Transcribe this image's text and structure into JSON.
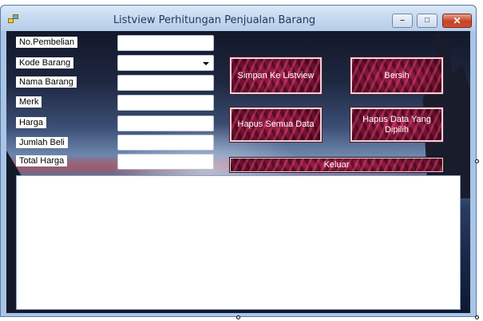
{
  "window": {
    "title": "Listview Perhitungan Penjualan Barang",
    "buttons": {
      "minimize_icon": "minimize-icon",
      "maximize_icon": "maximize-icon",
      "close_icon": "close-icon"
    }
  },
  "form": {
    "labels": {
      "no_pembelian": "No.Pembelian",
      "kode_barang": "Kode Barang",
      "nama_barang": "Nama Barang",
      "merk": "Merk",
      "harga": "Harga",
      "jumlah_beli": "Jumlah Beli",
      "total_harga": "Total Harga"
    },
    "values": {
      "no_pembelian": "",
      "kode_barang": "",
      "nama_barang": "",
      "merk": "",
      "harga": "",
      "jumlah_beli": "",
      "total_harga": ""
    }
  },
  "actions": {
    "simpan": "Simpan Ke Listview",
    "bersih": "Bersih",
    "hapus_semua": "Hapus Semua Data",
    "hapus_dipilih": "Hapus Data Yang Dipilih",
    "keluar": "Keluar"
  },
  "colors": {
    "button_base": "#8a1840",
    "titlebar": "#c3d7ef",
    "close_button": "#c7422a"
  }
}
